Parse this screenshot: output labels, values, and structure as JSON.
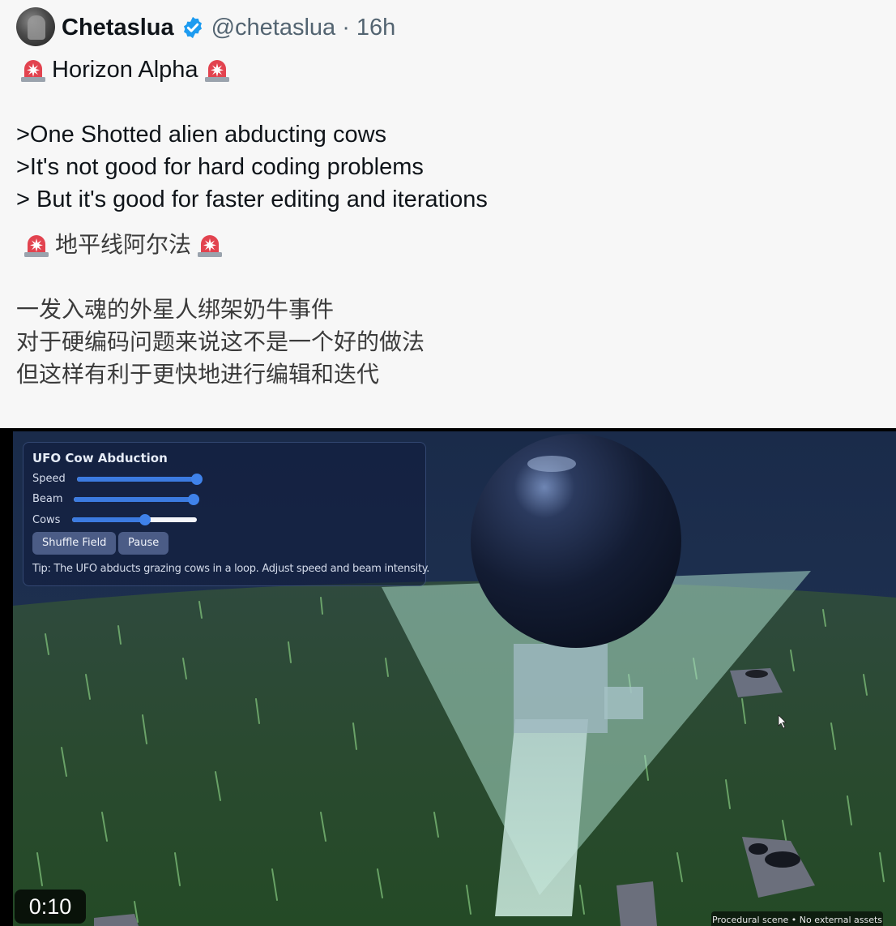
{
  "post": {
    "display_name": "Chetaslua",
    "handle": "@chetaslua",
    "separator": "·",
    "time": "16h",
    "title_en": "Horizon Alpha",
    "lines_en": [
      ">One Shotted alien abducting cows",
      ">It's not good for hard coding problems",
      "> But it's good for faster editing and iterations"
    ],
    "title_zh": "地平线阿尔法",
    "lines_zh": [
      "一发入魂的外星人绑架奶牛事件",
      "对于硬编码问题来说这不是一个好的做法",
      "但这样有利于更快地进行编辑和迭代"
    ]
  },
  "video": {
    "timestamp": "0:10",
    "credits": "Procedural scene • No external assets",
    "panel": {
      "title": "UFO Cow Abduction",
      "sliders": [
        {
          "label": "Speed",
          "value": 1.0
        },
        {
          "label": "Beam",
          "value": 0.97
        },
        {
          "label": "Cows",
          "value": 0.58
        }
      ],
      "buttons": [
        "Shuffle Field",
        "Pause"
      ],
      "tip": "Tip: The UFO abducts grazing cows in a loop. Adjust speed and beam intensity."
    }
  },
  "icons": [
    "verified-badge-icon",
    "siren-emoji-icon",
    "mouse-cursor-icon"
  ],
  "colors": {
    "verified": "#1d9bf0",
    "handle": "#536471",
    "slider_fill": "#3c7be0",
    "grass": "#2c4a33",
    "beam": "#b8e3d3"
  }
}
